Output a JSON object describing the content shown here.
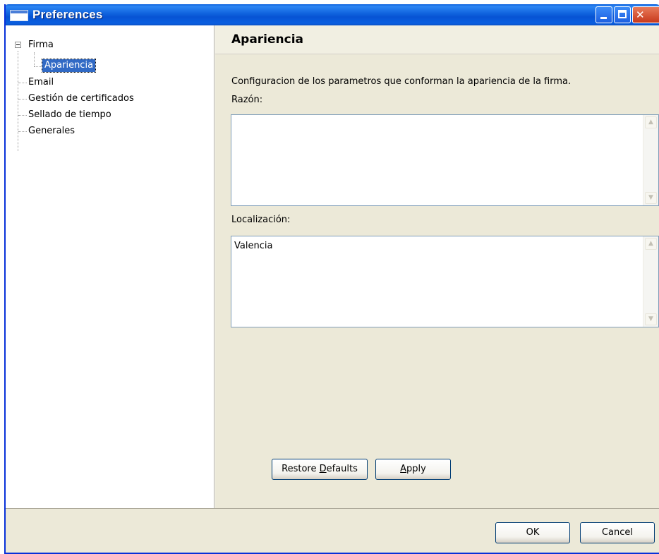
{
  "window": {
    "title": "Preferences"
  },
  "tree": {
    "items": [
      {
        "label": "Firma",
        "expanded": true
      },
      {
        "label": "Apariencia",
        "selected": true
      },
      {
        "label": "Email"
      },
      {
        "label": "Gestión de certificados"
      },
      {
        "label": "Sellado de tiempo"
      },
      {
        "label": "Generales"
      }
    ]
  },
  "page": {
    "title": "Apariencia",
    "description": "Configuracion de los parametros que conforman la apariencia de la firma.",
    "razon": {
      "label": "Razón:",
      "value": ""
    },
    "localizacion": {
      "label": "Localización:",
      "value": "Valencia"
    },
    "buttons": {
      "restore_defaults_pre": "Restore ",
      "restore_defaults_mnemonic": "D",
      "restore_defaults_post": "efaults",
      "apply_mnemonic": "A",
      "apply_post": "pply"
    }
  },
  "dialog_buttons": {
    "ok": "OK",
    "cancel": "Cancel"
  },
  "colors": {
    "titlebar": "#0a5fdc",
    "selection": "#316ac5",
    "dialog_bg": "#ece9d8"
  }
}
